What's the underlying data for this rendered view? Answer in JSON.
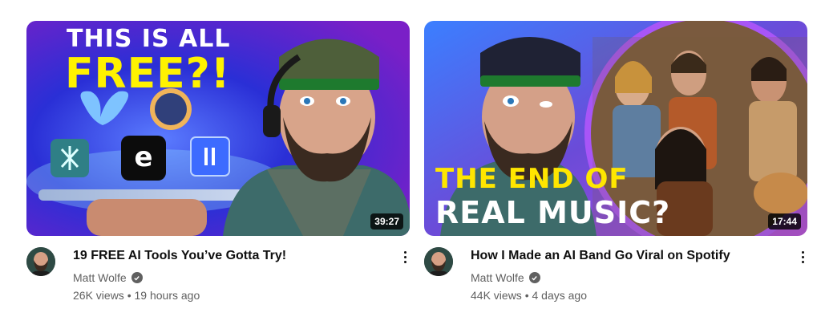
{
  "videos": [
    {
      "thumbnail_text": [
        "THIS IS ALL",
        "FREE?!"
      ],
      "duration": "39:27",
      "title": "19 FREE AI Tools You’ve Gotta Try!",
      "channel": "Matt Wolfe",
      "views": "26K views",
      "age": "19 hours ago",
      "separator": " • "
    },
    {
      "thumbnail_text": [
        "THE END OF",
        "REAL MUSIC?"
      ],
      "duration": "17:44",
      "title": "How I Made an AI Band Go Viral on Spotify",
      "channel": "Matt Wolfe",
      "views": "44K views",
      "age": "4 days ago",
      "separator": " • "
    }
  ],
  "colors": {
    "text_primary": "#0f0f0f",
    "text_secondary": "#606060",
    "thumb1_bg": "#2a2fd6",
    "thumb1_accent": "#fff200",
    "thumb2_accent": "#ffe600",
    "thumb2_ring": "#a855f7"
  },
  "icons": {
    "verified": "verified-check-icon",
    "more": "more-vert-icon"
  }
}
